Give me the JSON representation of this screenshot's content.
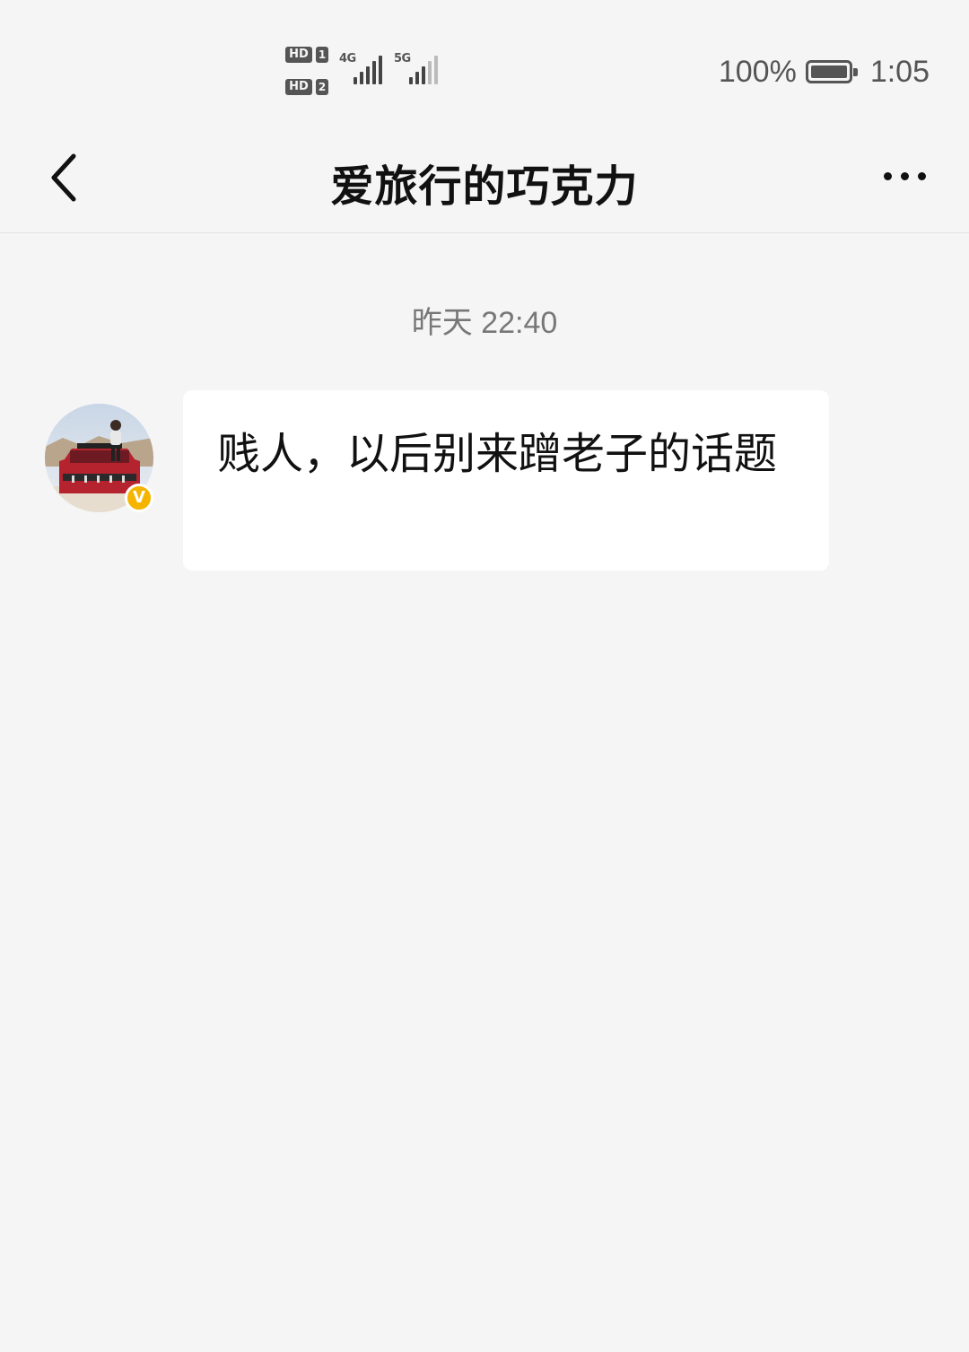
{
  "status_bar": {
    "sim1_badge": "HD",
    "sim1_num": "1",
    "sim2_badge": "HD",
    "sim2_num": "2",
    "net1": "4G",
    "net2": "5G",
    "battery_percent": "100%",
    "battery_level": 1.0,
    "time": "1:05"
  },
  "header": {
    "back_icon": "chevron-left-icon",
    "title": "爱旅行的巧克力",
    "more_icon": "more-horizontal-icon"
  },
  "chat": {
    "timestamp": "昨天 22:40",
    "messages": [
      {
        "sender": "other",
        "verified_badge": "V",
        "text": "贱人，以后别来蹭老子的话题"
      }
    ]
  },
  "colors": {
    "background": "#f5f5f5",
    "bubble": "#ffffff",
    "verified": "#f4b400",
    "timestamp": "#777777"
  }
}
